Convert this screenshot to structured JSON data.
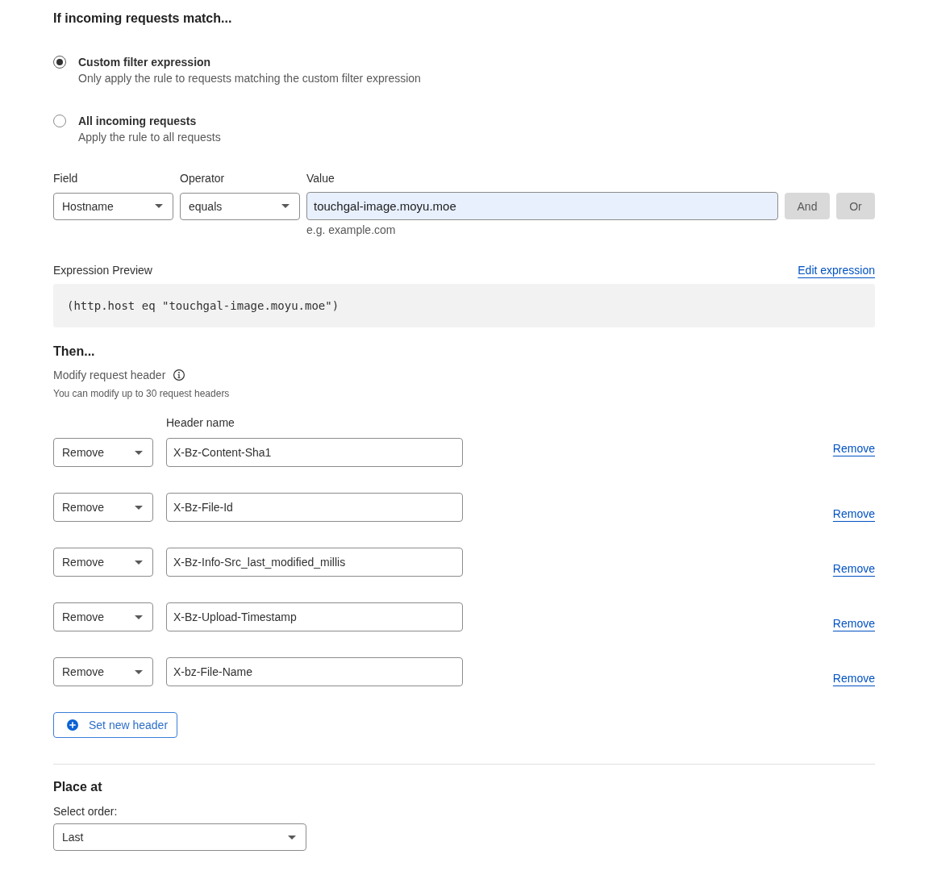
{
  "match": {
    "heading": "If incoming requests match...",
    "options": [
      {
        "label": "Custom filter expression",
        "description": "Only apply the rule to requests matching the custom filter expression",
        "selected": true
      },
      {
        "label": "All incoming requests",
        "description": "Apply the rule to all requests",
        "selected": false
      }
    ]
  },
  "filter": {
    "field": {
      "label": "Field",
      "value": "Hostname"
    },
    "operator": {
      "label": "Operator",
      "value": "equals"
    },
    "value": {
      "label": "Value",
      "value": "touchgal-image.moyu.moe",
      "hint": "e.g. example.com"
    },
    "buttons": [
      "And",
      "Or"
    ]
  },
  "preview": {
    "label": "Expression Preview",
    "link": "Edit expression",
    "expression": "(http.host eq \"touchgal-image.moyu.moe\")"
  },
  "then": {
    "heading": "Then...",
    "action": "Modify request header",
    "note": "You can modify up to 30 request headers",
    "column_label": "Header name",
    "headers": [
      {
        "operation": "Remove",
        "name": "X-Bz-Content-Sha1",
        "link": "Remove"
      },
      {
        "operation": "Remove",
        "name": "X-Bz-File-Id",
        "link": "Remove"
      },
      {
        "operation": "Remove",
        "name": "X-Bz-Info-Src_last_modified_millis",
        "link": "Remove"
      },
      {
        "operation": "Remove",
        "name": "X-Bz-Upload-Timestamp",
        "link": "Remove"
      },
      {
        "operation": "Remove",
        "name": "X-bz-File-Name",
        "link": "Remove"
      }
    ],
    "add_button": "Set new header"
  },
  "place": {
    "heading": "Place at",
    "label": "Select order:",
    "value": "Last"
  }
}
